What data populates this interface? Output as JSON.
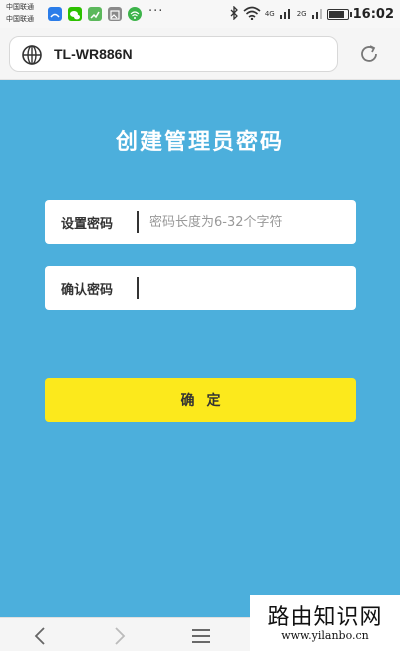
{
  "status_bar": {
    "carrier_1": "中国联通",
    "carrier_2": "中国联通",
    "more": "···",
    "network_4g": "4G",
    "network_2g": "2G",
    "battery_level": 0.9,
    "time": "16:02",
    "icons": [
      "alipay-icon",
      "wechat-icon",
      "chart-app-icon",
      "gallery-icon",
      "wifi-share-icon",
      "bluetooth-icon",
      "wifi-icon",
      "signal-icon",
      "battery-icon"
    ]
  },
  "browser": {
    "url": "TL-WR886N",
    "icons": [
      "globe-icon",
      "refresh-icon"
    ]
  },
  "page": {
    "title": "创建管理员密码",
    "set_password": {
      "label": "设置密码",
      "placeholder": "密码长度为6-32个字符",
      "value": ""
    },
    "confirm_password": {
      "label": "确认密码",
      "placeholder": "",
      "value": ""
    },
    "confirm_button": "确定",
    "colors": {
      "background": "#4cafdc",
      "button": "#fce91c",
      "title": "#ffffff"
    }
  },
  "nav": {
    "icons": [
      "back-icon",
      "forward-icon",
      "menu-icon"
    ]
  },
  "watermark": {
    "title": "路由知识网",
    "url": "www.yilanbo.cn"
  }
}
